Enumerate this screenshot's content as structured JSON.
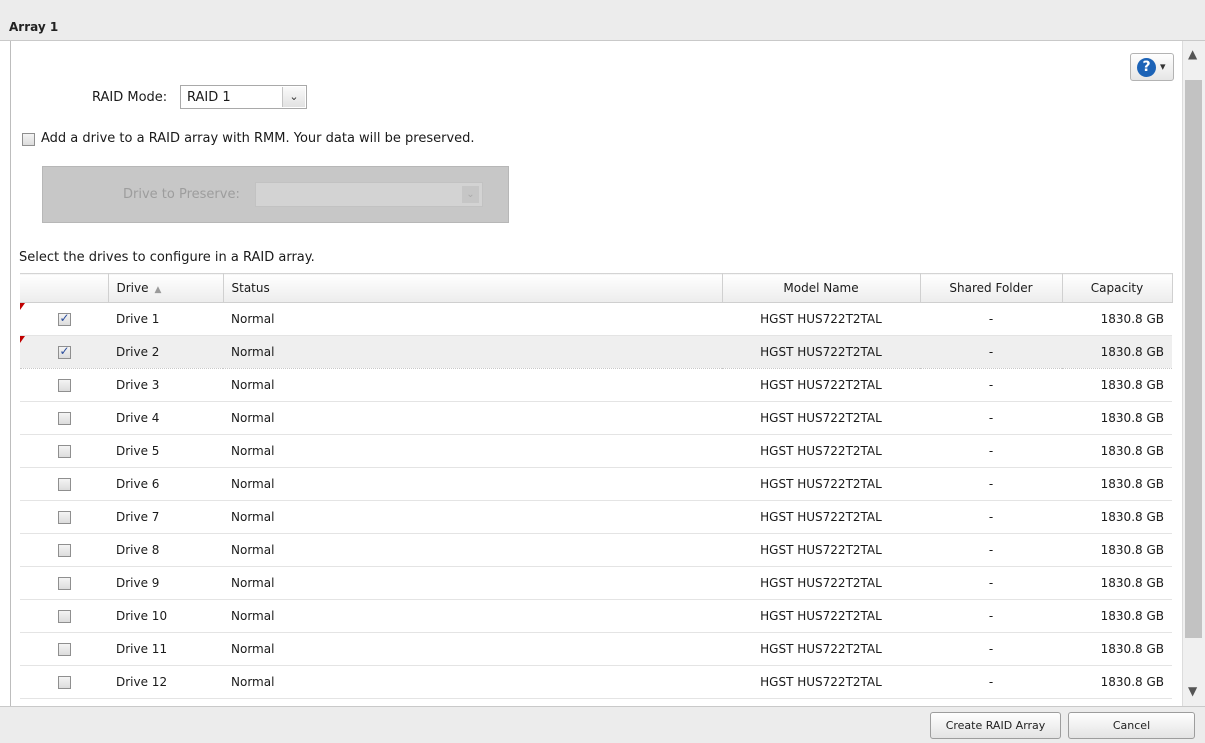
{
  "window": {
    "title": "Array 1"
  },
  "help": {
    "icon": "help-icon",
    "glyph": "?",
    "caret": "▾"
  },
  "raid_mode": {
    "label": "RAID Mode:",
    "value": "RAID 1",
    "arrow": "⌄"
  },
  "rmm": {
    "label": "Add a drive to a RAID array with RMM. Your data will be preserved.",
    "checked": false
  },
  "preserve": {
    "label": "Drive to Preserve:",
    "value": "",
    "arrow": "⌄"
  },
  "select_drives_text": "Select the drives to configure in a RAID array.",
  "table": {
    "headers": {
      "check": "",
      "drive": "Drive",
      "sort_glyph": "▲",
      "status": "Status",
      "model": "Model Name",
      "shared": "Shared Folder",
      "capacity": "Capacity"
    },
    "rows": [
      {
        "checked": true,
        "drive": "Drive 1",
        "status": "Normal",
        "model": "HGST HUS722T2TAL",
        "shared": "-",
        "capacity": "1830.8 GB"
      },
      {
        "checked": true,
        "drive": "Drive 2",
        "status": "Normal",
        "model": "HGST HUS722T2TAL",
        "shared": "-",
        "capacity": "1830.8 GB"
      },
      {
        "checked": false,
        "drive": "Drive 3",
        "status": "Normal",
        "model": "HGST HUS722T2TAL",
        "shared": "-",
        "capacity": "1830.8 GB"
      },
      {
        "checked": false,
        "drive": "Drive 4",
        "status": "Normal",
        "model": "HGST HUS722T2TAL",
        "shared": "-",
        "capacity": "1830.8 GB"
      },
      {
        "checked": false,
        "drive": "Drive 5",
        "status": "Normal",
        "model": "HGST HUS722T2TAL",
        "shared": "-",
        "capacity": "1830.8 GB"
      },
      {
        "checked": false,
        "drive": "Drive 6",
        "status": "Normal",
        "model": "HGST HUS722T2TAL",
        "shared": "-",
        "capacity": "1830.8 GB"
      },
      {
        "checked": false,
        "drive": "Drive 7",
        "status": "Normal",
        "model": "HGST HUS722T2TAL",
        "shared": "-",
        "capacity": "1830.8 GB"
      },
      {
        "checked": false,
        "drive": "Drive 8",
        "status": "Normal",
        "model": "HGST HUS722T2TAL",
        "shared": "-",
        "capacity": "1830.8 GB"
      },
      {
        "checked": false,
        "drive": "Drive 9",
        "status": "Normal",
        "model": "HGST HUS722T2TAL",
        "shared": "-",
        "capacity": "1830.8 GB"
      },
      {
        "checked": false,
        "drive": "Drive 10",
        "status": "Normal",
        "model": "HGST HUS722T2TAL",
        "shared": "-",
        "capacity": "1830.8 GB"
      },
      {
        "checked": false,
        "drive": "Drive 11",
        "status": "Normal",
        "model": "HGST HUS722T2TAL",
        "shared": "-",
        "capacity": "1830.8 GB"
      },
      {
        "checked": false,
        "drive": "Drive 12",
        "status": "Normal",
        "model": "HGST HUS722T2TAL",
        "shared": "-",
        "capacity": "1830.8 GB"
      }
    ]
  },
  "scrollbar": {
    "up": "▲",
    "down": "▼"
  },
  "buttons": {
    "create": "Create RAID Array",
    "cancel": "Cancel"
  },
  "colors": {
    "accent": "#1c63b7",
    "dirty_flag": "#c00000"
  }
}
